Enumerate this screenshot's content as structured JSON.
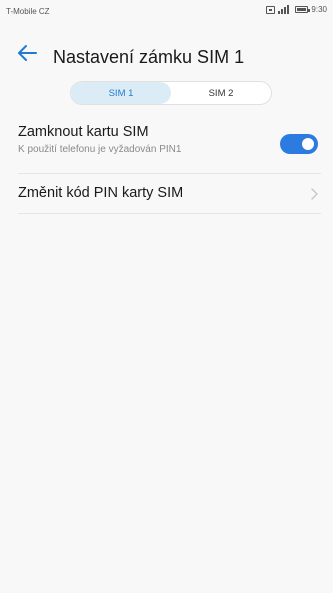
{
  "status_bar": {
    "carrier": "T-Mobile CZ",
    "time": "9:30"
  },
  "header": {
    "title": "Nastavení zámku SIM 1"
  },
  "tabs": [
    {
      "label": "SIM 1",
      "active": true
    },
    {
      "label": "SIM 2",
      "active": false
    }
  ],
  "settings": {
    "lock_sim": {
      "title": "Zamknout kartu SIM",
      "subtitle": "K použití telefonu je vyžadován PIN1",
      "enabled": true
    },
    "change_pin": {
      "title": "Změnit kód PIN karty SIM"
    }
  },
  "colors": {
    "accent": "#2b7be0",
    "tab_active_bg": "#dcecf7",
    "background": "#f8f8f8"
  },
  "icons": [
    "back-arrow-icon",
    "chevron-right-icon",
    "sim-icon",
    "signal-icon",
    "battery-icon"
  ]
}
